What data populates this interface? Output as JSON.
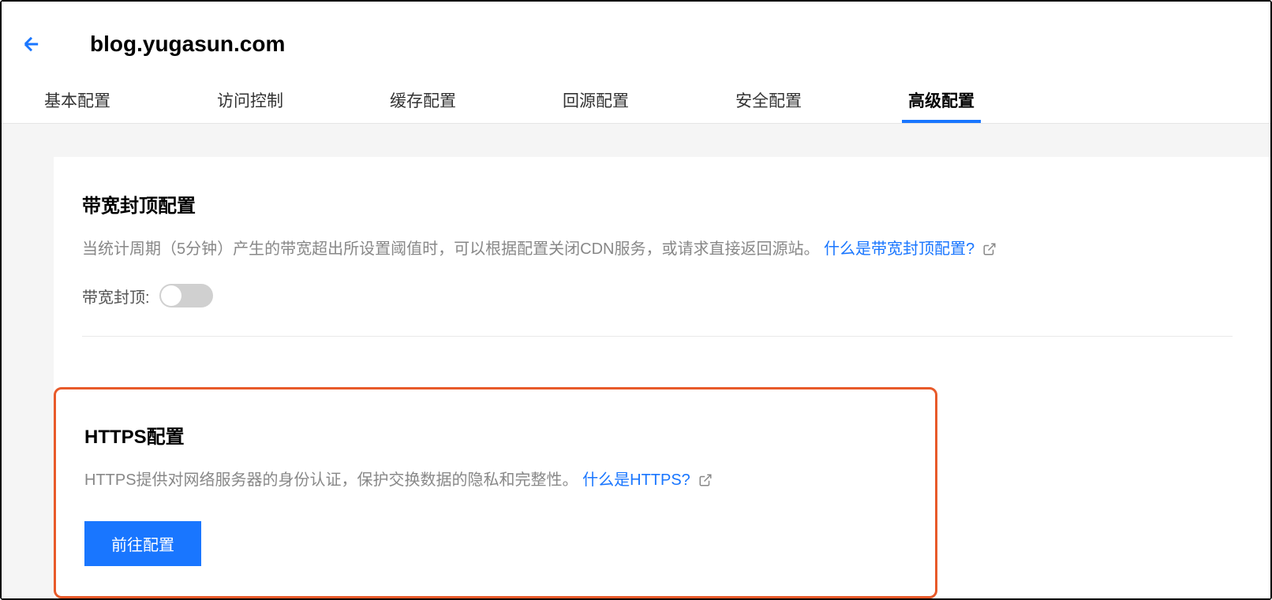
{
  "header": {
    "title": "blog.yugasun.com"
  },
  "tabs": [
    {
      "label": "基本配置",
      "active": false
    },
    {
      "label": "访问控制",
      "active": false
    },
    {
      "label": "缓存配置",
      "active": false
    },
    {
      "label": "回源配置",
      "active": false
    },
    {
      "label": "安全配置",
      "active": false
    },
    {
      "label": "高级配置",
      "active": true
    }
  ],
  "bandwidth_section": {
    "title": "带宽封顶配置",
    "description": "当统计周期（5分钟）产生的带宽超出所设置阈值时，可以根据配置关闭CDN服务，或请求直接返回源站。",
    "help_link": "什么是带宽封顶配置?",
    "toggle_label": "带宽封顶:"
  },
  "https_section": {
    "title": "HTTPS配置",
    "description": "HTTPS提供对网络服务器的身份认证，保护交换数据的隐私和完整性。",
    "help_link": "什么是HTTPS?",
    "button_label": "前往配置"
  }
}
